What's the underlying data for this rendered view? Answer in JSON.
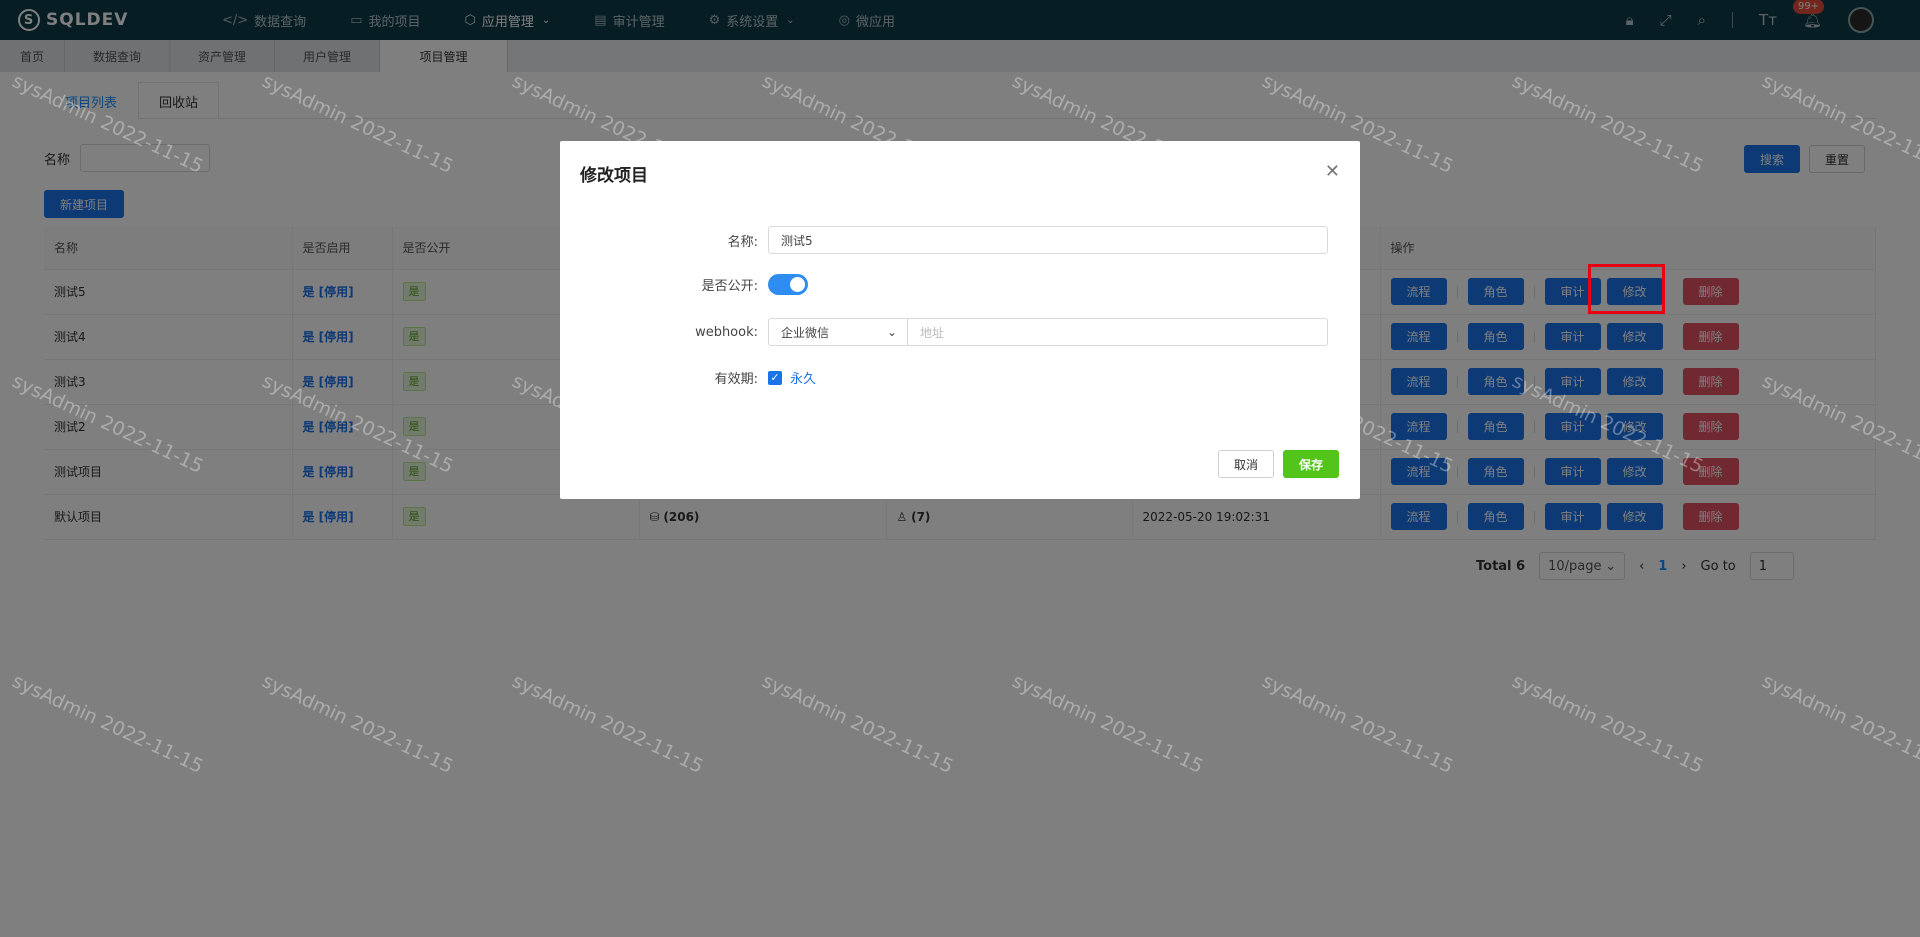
{
  "app": {
    "logo": "SQLDEV",
    "logo_mark": "S"
  },
  "topnav": {
    "items": [
      {
        "icon": "code-icon",
        "glyph": "</>",
        "label": "数据查询"
      },
      {
        "icon": "file-icon",
        "glyph": "▭",
        "label": "我的项目"
      },
      {
        "icon": "cube-icon",
        "glyph": "⬡",
        "label": "应用管理"
      },
      {
        "icon": "audit-icon",
        "glyph": "▤",
        "label": "审计管理"
      },
      {
        "icon": "gear-icon",
        "glyph": "⚙",
        "label": "系统设置"
      },
      {
        "icon": "app-icon",
        "glyph": "◎",
        "label": "微应用"
      }
    ],
    "notification_count": "99+"
  },
  "page_tabs": [
    "首页",
    "数据查询",
    "资产管理",
    "用户管理",
    "项目管理"
  ],
  "subtabs": [
    "项目列表",
    "回收站"
  ],
  "filter": {
    "name_label": "名称",
    "search": "搜索",
    "reset": "重置",
    "new_project": "新建项目"
  },
  "table": {
    "headers": [
      "名称",
      "是否启用",
      "是否公开",
      "",
      "",
      "",
      "操作"
    ],
    "rows": [
      {
        "name": "测试5",
        "enabled": "是 [停用]",
        "public": "是",
        "assets": "",
        "users": "",
        "created": ""
      },
      {
        "name": "测试4",
        "enabled": "是 [停用]",
        "public": "是",
        "assets": "",
        "users": "",
        "created": ""
      },
      {
        "name": "测试3",
        "enabled": "是 [停用]",
        "public": "是",
        "assets": "",
        "users": "",
        "created": ""
      },
      {
        "name": "测试2",
        "enabled": "是 [停用]",
        "public": "是",
        "assets": "",
        "users": "",
        "created": ""
      },
      {
        "name": "测试项目",
        "enabled": "是 [停用]",
        "public": "是",
        "assets": "",
        "users": "",
        "created": ""
      },
      {
        "name": "默认项目",
        "enabled": "是 [停用]",
        "public": "是",
        "assets": "(206)",
        "users": "(7)",
        "created": "2022-05-20 19:02:31"
      }
    ],
    "ops": {
      "flow": "流程",
      "role": "角色",
      "audit": "审计",
      "edit": "修改",
      "delete": "删除"
    }
  },
  "pager": {
    "total": "Total 6",
    "page_size": "10/page",
    "current": "1",
    "goto_label": "Go to",
    "goto_value": "1"
  },
  "watermark": "sysAdmin 2022-11-15",
  "modal": {
    "title": "修改项目",
    "name_label": "名称:",
    "name_value": "测试5",
    "public_label": "是否公开:",
    "webhook_label": "webhook:",
    "webhook_type": "企业微信",
    "webhook_placeholder": "地址",
    "validity_label": "有效期:",
    "validity_option": "永久",
    "cancel": "取消",
    "save": "保存"
  },
  "colors": {
    "primary": "#1a73e8",
    "danger": "#e05260",
    "success": "#52c41a",
    "nav_bg": "#0f3b48",
    "highlight": "#e60012"
  }
}
